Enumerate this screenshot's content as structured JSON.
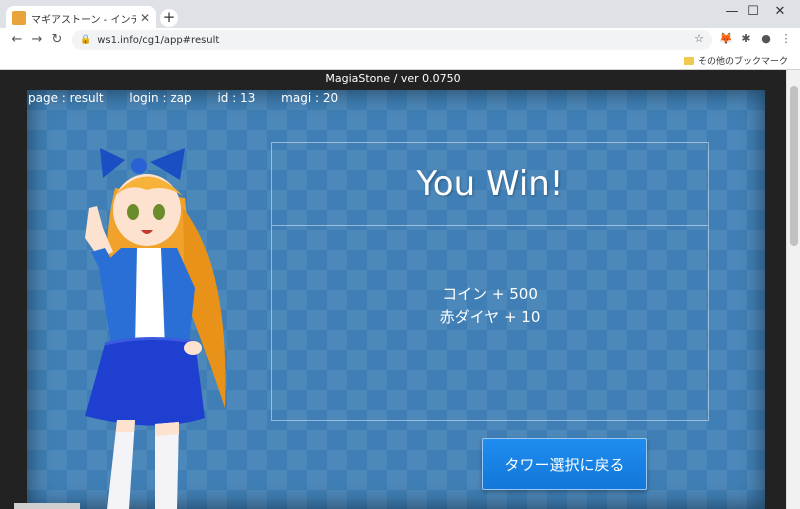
{
  "browser": {
    "tab_title": "マギアストーン - インディー・ブロックチェ",
    "tab_close": "✕",
    "new_tab": "+",
    "url": "ws1.info/cg1/app#result",
    "bookmark_other": "その他のブックマーク",
    "window_controls": {
      "minimize": "—",
      "maximize": "☐",
      "close": "✕"
    }
  },
  "app": {
    "header": "MagiaStone / ver 0.0750",
    "status": {
      "page": "page : result",
      "login": "login : zap",
      "id": "id : 13",
      "magi": "magi : 20"
    },
    "result": {
      "title": "You Win!",
      "rewards": [
        "コイン + 500",
        "赤ダイヤ + 10"
      ]
    },
    "back_button": "タワー選択に戻る"
  },
  "colors": {
    "game_bg": "#3f7fb5",
    "button": "#1f8df0"
  }
}
